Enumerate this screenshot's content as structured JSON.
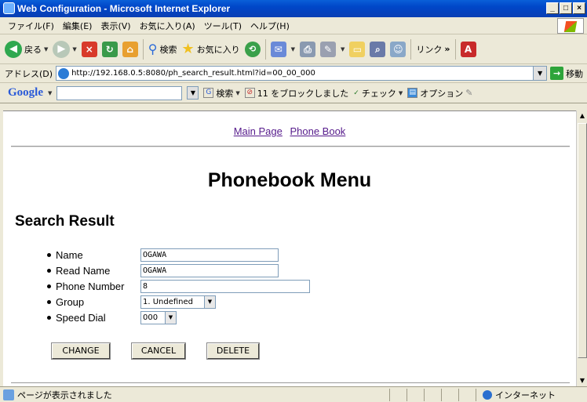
{
  "window": {
    "title": "Web Configuration - Microsoft Internet Explorer",
    "minimize": "_",
    "maximize": "□",
    "close": "×"
  },
  "menu": [
    "ファイル(F)",
    "編集(E)",
    "表示(V)",
    "お気に入り(A)",
    "ツール(T)",
    "ヘルプ(H)"
  ],
  "toolbar": {
    "back": "戻る",
    "search": "検索",
    "favorites": "お気に入り",
    "links": "リンク",
    "chevron": "»"
  },
  "address": {
    "label": "アドレス(D)",
    "url": "http://192.168.0.5:8080/ph_search_result.html?id=00_00_000",
    "go": "移動"
  },
  "google": {
    "logo": "Google",
    "search": "検索",
    "blocked": "11 をブロックしました",
    "check": "チェック",
    "options": "オプション"
  },
  "page": {
    "nav": [
      "Main Page",
      "Phone Book"
    ],
    "title": "Phonebook Menu",
    "section": "Search Result",
    "fields": {
      "name": {
        "label": "Name",
        "value": "OGAWA"
      },
      "read_name": {
        "label": "Read Name",
        "value": "OGAWA"
      },
      "phone": {
        "label": "Phone Number",
        "value": "8"
      },
      "group": {
        "label": "Group",
        "value": "1. Undefined"
      },
      "speed_dial": {
        "label": "Speed Dial",
        "value": "000"
      }
    },
    "buttons": {
      "change": "CHANGE",
      "cancel": "CANCEL",
      "delete": "DELETE"
    }
  },
  "status": {
    "text": "ページが表示されました",
    "zone": "インターネット"
  }
}
